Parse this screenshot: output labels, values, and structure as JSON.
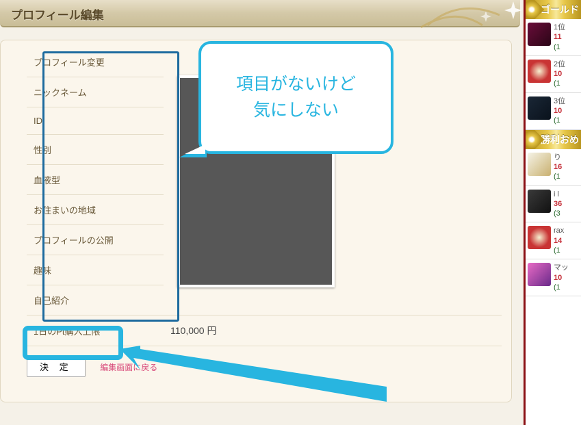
{
  "page_title": "プロフィール編集",
  "form_labels": [
    "プロフィール変更",
    "ニックネーム",
    "ID",
    "性別",
    "血液型",
    "お住まいの地域",
    "プロフィールの公開",
    "趣味",
    "自己紹介",
    "1日のPt購入上限"
  ],
  "form_values": {
    "pt_limit": "110,000 円"
  },
  "actions": {
    "decide": "決 定",
    "back": "編集画面に戻る"
  },
  "annotation": {
    "bubble_line1": "項目がないけど",
    "bubble_line2": "気にしない"
  },
  "sidebar": {
    "section_gold": "ゴールド",
    "section_shouri": "勝利おめ",
    "gold_items": [
      {
        "rank": "1位",
        "num": "11",
        "sub": "(1",
        "thumb_bg": "linear-gradient(135deg,#6a0d3a,#2a0516)"
      },
      {
        "rank": "2位",
        "num": "10",
        "sub": "(1",
        "thumb_bg": "radial-gradient(circle,#f6f0d0,#c93434 60%)"
      },
      {
        "rank": "3位",
        "num": "10",
        "sub": "(1",
        "thumb_bg": "linear-gradient(135deg,#1a2736,#0a121c)"
      }
    ],
    "shouri_items": [
      {
        "name": "り",
        "num": "16",
        "sub": "(1",
        "thumb_bg": "linear-gradient(135deg,#f5f3e6,#c9b070)"
      },
      {
        "name": "i l",
        "num": "36",
        "sub": "(3",
        "thumb_bg": "linear-gradient(135deg,#3a3a3a,#111)"
      },
      {
        "name": "rax",
        "num": "14",
        "sub": "(1",
        "thumb_bg": "radial-gradient(circle,#f6f0d0,#c93434 60%)"
      },
      {
        "name": "マッ",
        "num": "10",
        "sub": "(1",
        "thumb_bg": "linear-gradient(135deg,#e86bc5,#6a2a8a)"
      }
    ]
  }
}
